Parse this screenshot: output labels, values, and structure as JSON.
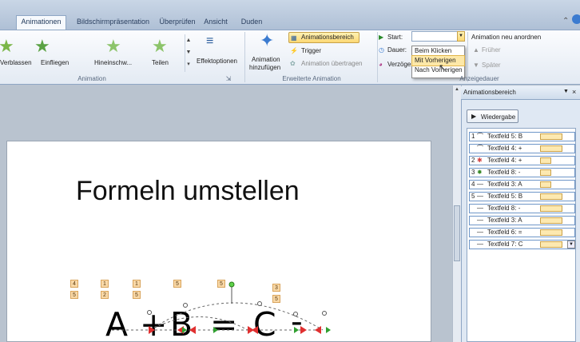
{
  "tabs": [
    {
      "label": "Animationen",
      "active": true
    },
    {
      "label": "Bildschirmpräsentation",
      "active": false
    },
    {
      "label": "Überprüfen",
      "active": false
    },
    {
      "label": "Ansicht",
      "active": false
    },
    {
      "label": "Duden",
      "active": false
    }
  ],
  "ribbon": {
    "effects": [
      "Verblassen",
      "Einfliegen",
      "Hineinschw...",
      "Teilen"
    ],
    "effect_options": "Effektoptionen",
    "group_animation": "Animation",
    "add_animation_line1": "Animation",
    "add_animation_line2": "hinzufügen",
    "animationsbereich": "Animationsbereich",
    "trigger": "Trigger",
    "animation_uebertragen": "Animation übertragen",
    "group_erweiterte": "Erweiterte Animation",
    "start_label": "Start:",
    "dauer_label": "Dauer:",
    "verzoeger_label": "Verzöger",
    "neu_anordnen": "Animation neu anordnen",
    "frueher": "Früher",
    "spaeter": "Später",
    "group_anzeigedauer": "Anzeigedauer",
    "start_options": [
      "Beim Klicken",
      "Mit Vorherigen",
      "Nach Vorherigen"
    ],
    "start_highlighted": "Mit Vorherigen"
  },
  "pane": {
    "title": "Animationsbereich",
    "play": "Wiedergabe",
    "items": [
      {
        "num": "1",
        "icon": "arc",
        "label": "Textfeld 5: B"
      },
      {
        "num": "",
        "icon": "arc",
        "label": "Textfeld 4: +"
      },
      {
        "num": "2",
        "icon": "spin",
        "label": "Textfeld 4: +"
      },
      {
        "num": "3",
        "icon": "sparkle",
        "label": "Textfeld 8: -"
      },
      {
        "num": "4",
        "icon": "line",
        "label": "Textfeld 3: A"
      },
      {
        "num": "5",
        "icon": "line",
        "label": "Textfeld 5: B"
      },
      {
        "num": "",
        "icon": "line",
        "label": "Textfeld 8: -"
      },
      {
        "num": "",
        "icon": "line",
        "label": "Textfeld 3: A"
      },
      {
        "num": "",
        "icon": "line",
        "label": "Textfeld 6: ="
      },
      {
        "num": "",
        "icon": "line",
        "label": "Textfeld 7: C"
      }
    ]
  },
  "slide": {
    "title": "Formeln umstellen",
    "formula": [
      "A",
      "+",
      "B",
      "=",
      "C",
      "-"
    ],
    "badges": [
      "4",
      "5",
      "1",
      "2",
      "1",
      "5",
      "5",
      "5",
      "3",
      "5"
    ]
  },
  "colors": {
    "accent": "#fcd874",
    "selection": "#6e96c8",
    "bar": "#fde9b0"
  }
}
